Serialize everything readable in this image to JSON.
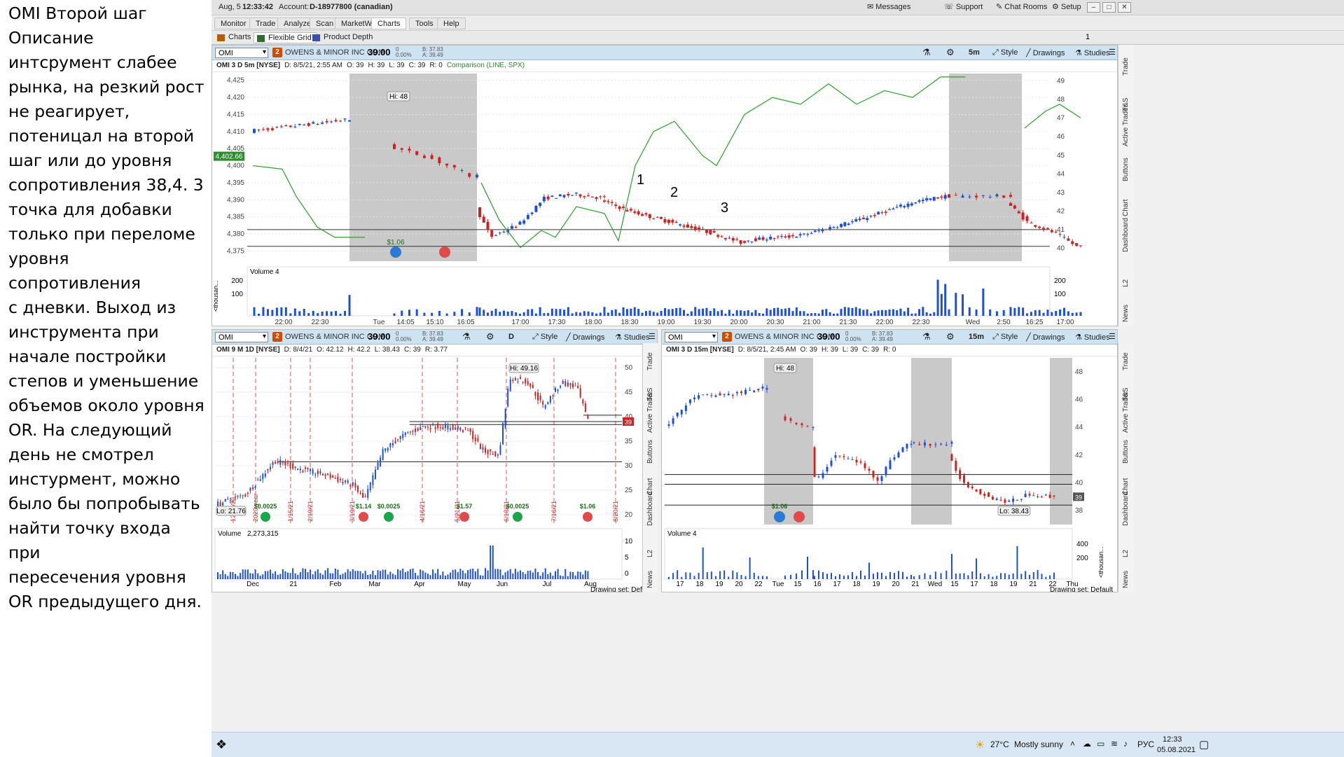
{
  "note": {
    "text": "OMI Второй шаг\nОписание\nинтсрумент слабее\nрынка, на резкий рост\nне реагирует,\nпотеницал на второй\nшаг или до уровня\nсопротивления 38,4. 3\nточка для добавки\nтолько при переломе\nуровня сопротивления\nс дневки. Выход из\nинструмента при\nначале постройки\nстепов и уменьшение\nобъемов около уровня\nOR. На следующий\nдень не смотрел\nинстурмент, можно\nбыло бы попробывать\nнайти точку входа при\nпересечения уровня\nOR предыдущего дня."
  },
  "titlebar": {
    "date": "Aug, 5",
    "time": "12:33:42",
    "account_label": "Account:",
    "account": "D-18977800 (canadian)",
    "messages": "Messages",
    "support": "Support",
    "chat": "Chat Rooms",
    "setup": "Setup"
  },
  "menu": [
    "Monitor",
    "Trade",
    "Analyze",
    "Scan",
    "MarketWatch",
    "Charts",
    "Tools",
    "Help"
  ],
  "subtabs": [
    "Charts",
    "Flexible Grid",
    "Product Depth"
  ],
  "grid_count": "1",
  "top": {
    "symbol": "OMI",
    "badge": "2",
    "company": "OWENS & MINOR INC COM",
    "price": "39.00",
    "change": "0",
    "pct": "0.00%",
    "bid": "B: 37.83",
    "ask": "A: 39.49",
    "period": "5m",
    "style": "Style",
    "drawings": "Drawings",
    "studies": "Studies",
    "info": {
      "title": "OMI 3 D 5m [NYSE]",
      "d": "D: 8/5/21, 2:55 AM",
      "o": "O: 39",
      "h": "H: 39",
      "l": "L: 39",
      "c": "C: 39",
      "r": "R: 0",
      "cmp": "Comparison (LINE, SPX)"
    },
    "price_ticks": [
      "4,425",
      "4,420",
      "4,415",
      "4,410",
      "4,405",
      "4,400",
      "4,395",
      "4,390",
      "4,385",
      "4,380",
      "4,375"
    ],
    "right_ticks": [
      "49",
      "48",
      "47",
      "46",
      "45",
      "44",
      "43",
      "42",
      "41",
      "40"
    ],
    "current_tag": "4,402.66",
    "hi_label": "Hi: 48",
    "div_label": "$1.06",
    "annotations": [
      "1",
      "2",
      "3"
    ],
    "volume_label": "Volume",
    "volume_value": "4",
    "vol_ticks": [
      "200",
      "100"
    ],
    "vol_unit": "<thousan...",
    "time_ticks": [
      "22:00",
      "22:30",
      "Tue",
      "14:05",
      "15:10",
      "16:05",
      "17:00",
      "17:30",
      "18:00",
      "18:30",
      "19:00",
      "19:30",
      "20:00",
      "20:30",
      "21:00",
      "21:30",
      "22:00",
      "22:30",
      "Wed",
      "2:50",
      "16:25",
      "17:00"
    ],
    "drawing_set": "Drawing set: Default"
  },
  "bl": {
    "symbol": "OMI",
    "badge": "2",
    "company": "OWENS & MINOR INC COM",
    "price": "39.00",
    "change": "0",
    "pct": "0.00%",
    "bid": "B: 37.83",
    "ask": "A: 39.49",
    "period": "D",
    "style": "Style",
    "drawings": "Drawings",
    "studies": "Studies",
    "info": {
      "title": "OMI 9 M 1D [NYSE]",
      "d": "D: 8/4/21",
      "o": "O: 42.12",
      "h": "H: 42.2",
      "l": "L: 38.43",
      "c": "C: 39",
      "r": "R: 3.77"
    },
    "price_ticks": [
      "50",
      "45",
      "40",
      "35",
      "30",
      "25",
      "20"
    ],
    "tag": "39",
    "hi_label": "Hi: 49.16",
    "lo_label": "Lo: 21.76",
    "date_marks": [
      "12/18/20",
      "2020 year",
      "1/15/21",
      "2/19/21",
      "3/19/21",
      "4/16/21",
      "5/21/21",
      "6/18/21",
      "7/16/21",
      "8/20/21"
    ],
    "div_labels": [
      "$0.0025",
      "$1.14",
      "$0.0025",
      "$1.57",
      "$0.0025",
      "$1.06"
    ],
    "volume_label": "Volume",
    "volume_value": "2,273,315",
    "vol_ticks": [
      "10",
      "5",
      "0"
    ],
    "vol_unit": "<millions>",
    "time_ticks": [
      "Dec",
      "21",
      "Feb",
      "Mar",
      "Apr",
      "May",
      "Jun",
      "Jul",
      "Aug"
    ],
    "drawing_set": "Drawing set: Default"
  },
  "br": {
    "symbol": "OMI",
    "badge": "2",
    "company": "OWENS & MINOR INC COM",
    "price": "39.00",
    "change": "0",
    "pct": "0.00%",
    "bid": "B: 37.83",
    "ask": "A: 39.49",
    "period": "15m",
    "style": "Style",
    "drawings": "Drawings",
    "studies": "Studies",
    "info": {
      "title": "OMI 3 D 15m [NYSE]",
      "d": "D: 8/5/21, 2:45 AM",
      "o": "O: 39",
      "h": "H: 39",
      "l": "L: 39",
      "c": "C: 39",
      "r": "R: 0"
    },
    "price_ticks": [
      "48",
      "46",
      "44",
      "42",
      "40",
      "38"
    ],
    "tag": "39",
    "hi_label": "Hi: 48",
    "lo_label": "Lo: 38.43",
    "div_label": "$1.06",
    "volume_label": "Volume",
    "volume_value": "4",
    "vol_ticks": [
      "400",
      "200"
    ],
    "vol_unit": "<thousan...",
    "time_ticks": [
      "17",
      "18",
      "19",
      "20",
      "22",
      "Tue",
      "15",
      "16",
      "17",
      "18",
      "19",
      "20",
      "21",
      "Wed",
      "15",
      "17",
      "18",
      "19",
      "21",
      "22",
      "Thu"
    ],
    "drawing_set": "Drawing set: Default"
  },
  "side_tabs": [
    "Trade",
    "T&S",
    "Active Trader",
    "Buttons",
    "Chart",
    "Dashboard",
    "L2",
    "News"
  ],
  "taskbar": {
    "temp": "27°C",
    "weather": "Mostly sunny",
    "lang": "РУС",
    "time": "12:33",
    "date": "05.08.2021"
  },
  "colors": {
    "up": "#1e4fd8",
    "down": "#cc2222",
    "spx": "#2e9e2e",
    "session": "#c9c9c9",
    "vol": "#1e4fd8",
    "toolbar": "#cde3f2"
  }
}
